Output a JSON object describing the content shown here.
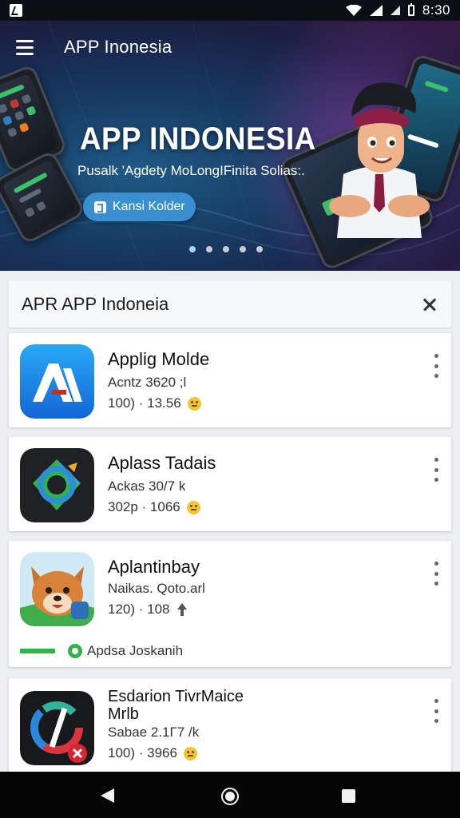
{
  "status_bar": {
    "time": "8:30",
    "icons": [
      "app-notification-icon",
      "wifi-icon",
      "signal-icon",
      "battery-icon"
    ]
  },
  "toolbar": {
    "title": "APP Inonesia",
    "menu_icon": "menu-icon"
  },
  "hero": {
    "title": "APP INDONESIA",
    "subtitle": "Pusalk 'Agdety MoLongIFinita Solias:.",
    "button_label": "Kansi Kolder",
    "carousel_dots": 5,
    "active_dot": 0
  },
  "list": {
    "title": "APR APP Indoneia",
    "close_icon": "close-icon"
  },
  "apps": [
    {
      "name": "Applig Molde",
      "meta": "Acntz 3620 ;l",
      "stats": "100) · 13.56",
      "stat_icon": "emoji-icon"
    },
    {
      "name": "Aplass Tadais",
      "meta": "Ackas 30/7 k",
      "stats": "302p · 1066",
      "stat_icon": "emoji-icon"
    },
    {
      "name": "Aplantinbay",
      "meta": "Naikas. Qoto.arl",
      "stats": "120) · 108",
      "stat_icon": "arrow-up-icon",
      "action_label": "Apdsa Joskanih"
    },
    {
      "name_line1": "Esdarion TivrMaice",
      "name_line2": "Mrlb",
      "meta": "Sabae 2.1Γ7 /k",
      "stats": "100) · 3966",
      "stat_icon": "emoji-icon"
    }
  ],
  "colors": {
    "accent_button": "#3a8fd0",
    "action_green": "#2fb34a",
    "background": "#eceef1"
  },
  "nav": {
    "icons": [
      "back-icon",
      "home-icon",
      "recents-icon"
    ]
  }
}
